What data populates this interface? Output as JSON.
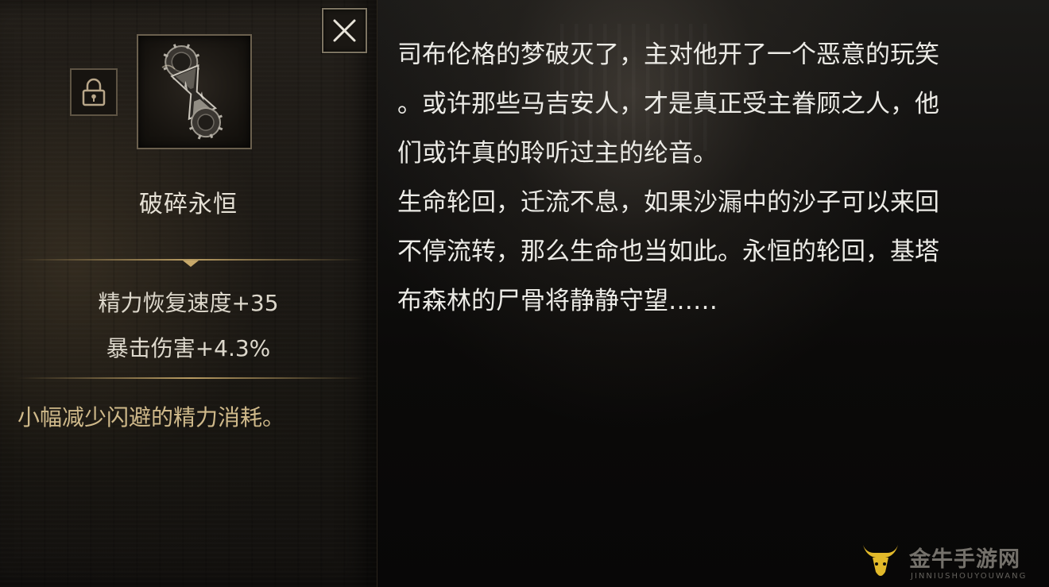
{
  "item": {
    "name": "破碎永恒",
    "icon": "broken-hourglass-icon",
    "locked": true,
    "stats": [
      "精力恢复速度+35",
      "暴击伤害+4.3%"
    ],
    "effect": "小幅减少闪避的精力消耗。"
  },
  "controls": {
    "close_icon": "close-icon",
    "lock_icon": "lock-icon"
  },
  "lore": {
    "lines": [
      "司布伦格的梦破灭了，主对他开了一个恶意的玩笑",
      "。或许那些马吉安人，才是真正受主眷顾之人，他",
      "们或许真的聆听过主的纶音。",
      "生命轮回，迁流不息，如果沙漏中的沙子可以来回",
      "不停流转，那么生命也当如此。永恒的轮回，基塔",
      "布森林的尸骨将静静守望……"
    ]
  },
  "watermark": {
    "title": "金牛手游网",
    "subtitle": "JINNIUSHOUYOUWANG"
  },
  "colors": {
    "gold_accent": "#c8a96a",
    "effect_text": "#cfb98a",
    "frame_border": "#6b604e"
  }
}
